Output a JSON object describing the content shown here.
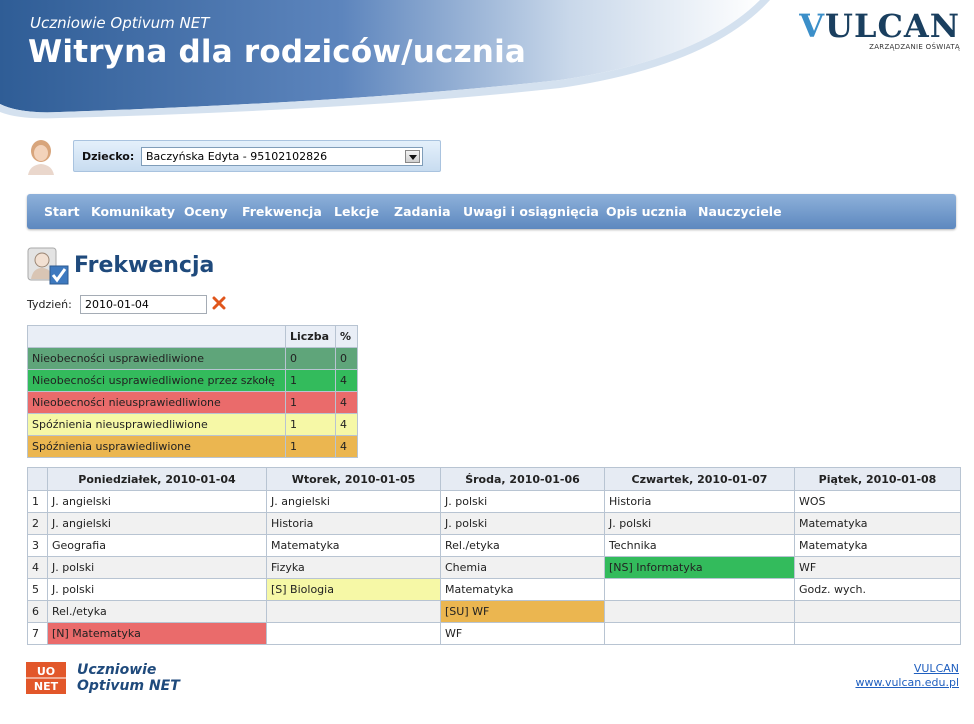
{
  "header": {
    "app_subtitle": "Uczniowie Optivum NET",
    "app_title": "Witryna dla rodziców/ucznia",
    "logo_word": "VULCAN",
    "logo_sub": "ZARZĄDZANIE OŚWIATĄ"
  },
  "child": {
    "label": "Dziecko:",
    "selected": "Baczyńska Edyta - 95102102826"
  },
  "nav": [
    "Start",
    "Komunikaty",
    "Oceny",
    "Frekwencja",
    "Lekcje",
    "Zadania",
    "Uwagi i osiągnięcia",
    "Opis ucznia",
    "Nauczyciele"
  ],
  "page": {
    "title": "Frekwencja",
    "week_label": "Tydzień:",
    "week_value": "2010-01-04"
  },
  "summary": {
    "headers": [
      "",
      "Liczba",
      "%"
    ],
    "rows": [
      {
        "label": "Nieobecności usprawiedliwione",
        "count": "0",
        "pct": "0",
        "color": "#5fa57a"
      },
      {
        "label": "Nieobecności usprawiedliwione przez szkołę",
        "count": "1",
        "pct": "4",
        "color": "#33bb5c"
      },
      {
        "label": "Nieobecności nieusprawiedliwione",
        "count": "1",
        "pct": "4",
        "color": "#ea6b6b"
      },
      {
        "label": "Spóźnienia nieusprawiedliwione",
        "count": "1",
        "pct": "4",
        "color": "#f6f8a6"
      },
      {
        "label": "Spóźnienia usprawiedliwione",
        "count": "1",
        "pct": "4",
        "color": "#ebb650"
      }
    ]
  },
  "schedule": {
    "days": [
      "Poniedziałek, 2010-01-04",
      "Wtorek, 2010-01-05",
      "Środa, 2010-01-06",
      "Czwartek, 2010-01-07",
      "Piątek, 2010-01-08"
    ],
    "rows": [
      {
        "n": "1",
        "cells": [
          {
            "t": "J. angielski"
          },
          {
            "t": "J. angielski"
          },
          {
            "t": "J. polski"
          },
          {
            "t": "Historia"
          },
          {
            "t": "WOS"
          }
        ]
      },
      {
        "n": "2",
        "cells": [
          {
            "t": "J. angielski"
          },
          {
            "t": "Historia"
          },
          {
            "t": "J. polski"
          },
          {
            "t": "J. polski"
          },
          {
            "t": "Matematyka"
          }
        ]
      },
      {
        "n": "3",
        "cells": [
          {
            "t": "Geografia"
          },
          {
            "t": "Matematyka"
          },
          {
            "t": "Rel./etyka"
          },
          {
            "t": "Technika"
          },
          {
            "t": "Matematyka"
          }
        ]
      },
      {
        "n": "4",
        "cells": [
          {
            "t": "J. polski"
          },
          {
            "t": "Fizyka"
          },
          {
            "t": "Chemia"
          },
          {
            "t": "[NS] Informatyka",
            "c": "#33bb5c"
          },
          {
            "t": "WF"
          }
        ]
      },
      {
        "n": "5",
        "cells": [
          {
            "t": "J. polski"
          },
          {
            "t": "[S] Biologia",
            "c": "#f6f8a6"
          },
          {
            "t": "Matematyka"
          },
          {
            "t": ""
          },
          {
            "t": "Godz. wych."
          }
        ]
      },
      {
        "n": "6",
        "cells": [
          {
            "t": "Rel./etyka"
          },
          {
            "t": ""
          },
          {
            "t": "[SU] WF",
            "c": "#ebb650"
          },
          {
            "t": ""
          },
          {
            "t": ""
          }
        ]
      },
      {
        "n": "7",
        "cells": [
          {
            "t": "[N] Matematyka",
            "c": "#ea6b6b"
          },
          {
            "t": ""
          },
          {
            "t": "WF"
          },
          {
            "t": ""
          },
          {
            "t": ""
          }
        ]
      }
    ]
  },
  "footer": {
    "logo_top": "UO",
    "logo_bottom": "NET",
    "brand_line1": "Uczniowie",
    "brand_line2": "Optivum NET",
    "link1": "VULCAN",
    "link2": "www.vulcan.edu.pl"
  }
}
